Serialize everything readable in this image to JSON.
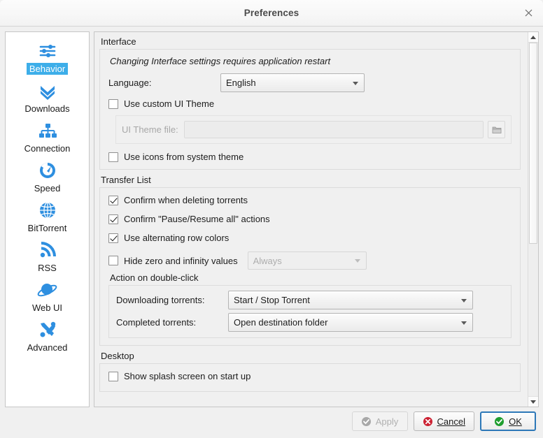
{
  "window": {
    "title": "Preferences",
    "close_icon": "close-icon"
  },
  "sidebar": {
    "items": [
      {
        "label": "Behavior",
        "icon": "sliders-icon",
        "selected": true
      },
      {
        "label": "Downloads",
        "icon": "double-chevron-down-icon",
        "selected": false
      },
      {
        "label": "Connection",
        "icon": "network-tree-icon",
        "selected": false
      },
      {
        "label": "Speed",
        "icon": "speedometer-icon",
        "selected": false
      },
      {
        "label": "BitTorrent",
        "icon": "globe-icon",
        "selected": false
      },
      {
        "label": "RSS",
        "icon": "rss-icon",
        "selected": false
      },
      {
        "label": "Web UI",
        "icon": "planet-icon",
        "selected": false
      },
      {
        "label": "Advanced",
        "icon": "tools-icon",
        "selected": false
      }
    ]
  },
  "interface": {
    "group_title": "Interface",
    "restart_note": "Changing Interface settings requires application restart",
    "language_label": "Language:",
    "language_value": "English",
    "language_options": [
      "English"
    ],
    "use_custom_theme": {
      "label": "Use custom UI Theme",
      "checked": false
    },
    "theme_file_label": "UI Theme file:",
    "theme_file_value": "",
    "browse_icon": "folder-icon",
    "use_system_icons": {
      "label": "Use icons from system theme",
      "checked": false
    }
  },
  "transfer_list": {
    "group_title": "Transfer List",
    "checkboxes": [
      {
        "label": "Confirm when deleting torrents",
        "checked": true
      },
      {
        "label": "Confirm \"Pause/Resume all\" actions",
        "checked": true
      },
      {
        "label": "Use alternating row colors",
        "checked": true
      }
    ],
    "hide_zero": {
      "label": "Hide zero and infinity values",
      "checked": false
    },
    "hide_zero_value": "Always",
    "hide_zero_options": [
      "Always"
    ],
    "double_click": {
      "title": "Action on double-click",
      "downloading_label": "Downloading torrents:",
      "downloading_value": "Start / Stop Torrent",
      "downloading_options": [
        "Start / Stop Torrent"
      ],
      "completed_label": "Completed torrents:",
      "completed_value": "Open destination folder",
      "completed_options": [
        "Open destination folder"
      ]
    }
  },
  "desktop": {
    "group_title": "Desktop",
    "splash": {
      "label": "Show splash screen on start up",
      "checked": false
    }
  },
  "scrollbar": {
    "up_icon": "scroll-up-icon",
    "down_icon": "scroll-down-icon",
    "thumb_top_pct": 0,
    "thumb_height_pct": 57
  },
  "footer": {
    "apply": {
      "label": "Apply",
      "icon": "check-circle-grey-icon",
      "enabled": false
    },
    "cancel": {
      "label": "Cancel",
      "icon": "x-circle-red-icon",
      "mnemonic": "C"
    },
    "ok": {
      "label": "OK",
      "icon": "check-circle-green-icon",
      "mnemonic": "O",
      "default": true
    }
  },
  "colors": {
    "accent": "#3daee9",
    "icon_blue": "#2e8fe0",
    "ok_green": "#1f9e2f",
    "cancel_red": "#cc2233",
    "default_border": "#2d78b8"
  }
}
